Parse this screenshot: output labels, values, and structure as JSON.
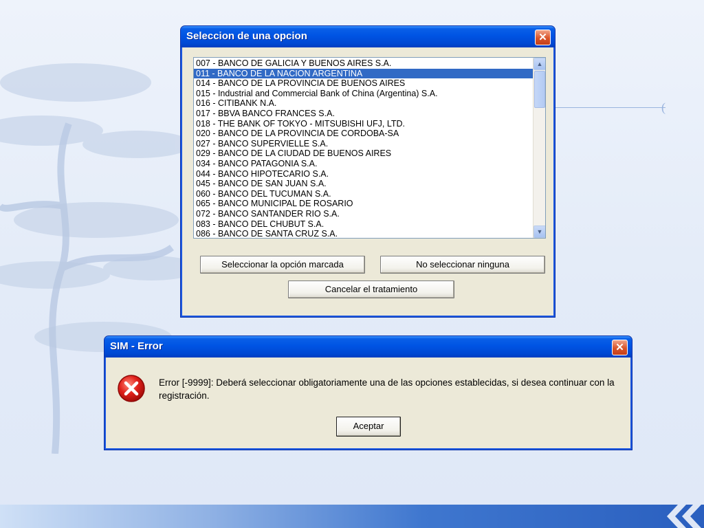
{
  "selection_dialog": {
    "title": "Seleccion de una opcion",
    "items": [
      "007 - BANCO DE GALICIA Y BUENOS AIRES S.A.",
      "011 - BANCO DE LA NACION ARGENTINA",
      "014 - BANCO DE LA PROVINCIA DE BUENOS AIRES",
      "015 - Industrial and Commercial Bank of China (Argentina) S.A.",
      "016 - CITIBANK N.A.",
      "017 - BBVA BANCO FRANCES S.A.",
      "018 - THE BANK OF TOKYO - MITSUBISHI UFJ, LTD.",
      "020 - BANCO DE LA PROVINCIA DE CORDOBA-SA",
      "027 - BANCO SUPERVIELLE S.A.",
      "029 - BANCO DE LA CIUDAD DE BUENOS AIRES",
      "034 - BANCO PATAGONIA S.A.",
      "044 - BANCO HIPOTECARIO S.A.",
      "045 - BANCO DE SAN JUAN S.A.",
      "060 - BANCO DEL TUCUMAN S.A.",
      "065 - BANCO MUNICIPAL DE ROSARIO",
      "072 - BANCO SANTANDER RIO S.A.",
      "083 - BANCO DEL CHUBUT S.A.",
      "086 - BANCO DE SANTA CRUZ S.A."
    ],
    "selected_index": 1,
    "select_button": "Seleccionar la opción marcada",
    "none_button": "No seleccionar ninguna",
    "cancel_button": "Cancelar el  tratamiento"
  },
  "error_dialog": {
    "title": "SIM - Error",
    "message": "Error [-9999]: Deberá seleccionar obligatoriamente una de las opciones establecidas, si desea continuar con la registración.",
    "ok_button": "Aceptar"
  },
  "colors": {
    "title_bar": "#0054e3",
    "selection": "#316ac5",
    "dialog_face": "#ece9d8"
  },
  "icons": {
    "close": "close-icon",
    "error": "error-icon"
  }
}
